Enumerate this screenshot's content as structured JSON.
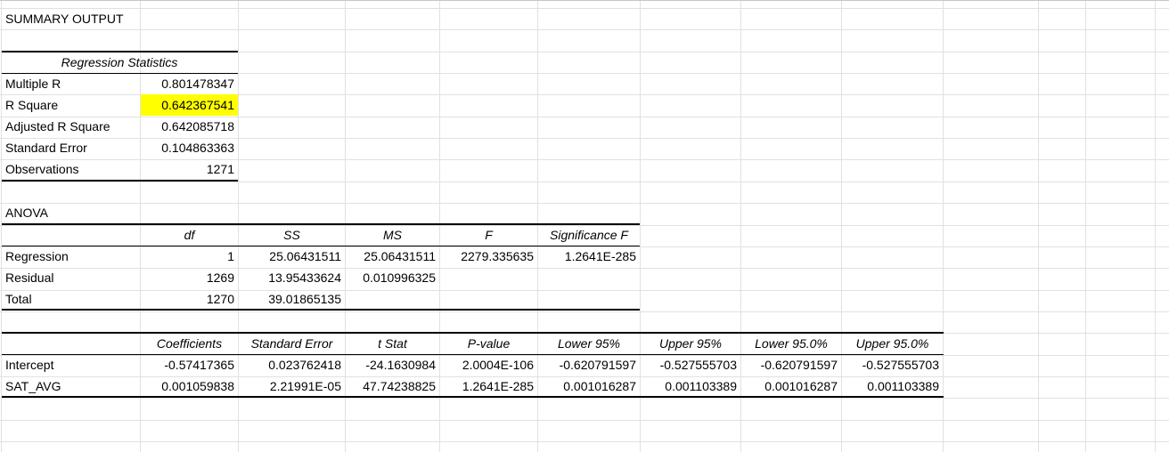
{
  "summary_title": "SUMMARY OUTPUT",
  "regression_statistics": {
    "header": "Regression Statistics",
    "rows": [
      {
        "label": "Multiple R",
        "value": "0.801478347"
      },
      {
        "label": "R Square",
        "value": "0.642367541"
      },
      {
        "label": "Adjusted R Square",
        "value": "0.642085718"
      },
      {
        "label": "Standard Error",
        "value": "0.104863363"
      },
      {
        "label": "Observations",
        "value": "1271"
      }
    ]
  },
  "anova": {
    "title": "ANOVA",
    "headers": [
      "df",
      "SS",
      "MS",
      "F",
      "Significance F"
    ],
    "rows": [
      {
        "label": "Regression",
        "df": "1",
        "ss": "25.06431511",
        "ms": "25.06431511",
        "f": "2279.335635",
        "sig": "1.2641E-285"
      },
      {
        "label": "Residual",
        "df": "1269",
        "ss": "13.95433624",
        "ms": "0.010996325",
        "f": "",
        "sig": ""
      },
      {
        "label": "Total",
        "df": "1270",
        "ss": "39.01865135",
        "ms": "",
        "f": "",
        "sig": ""
      }
    ]
  },
  "coefficients": {
    "headers": [
      "Coefficients",
      "Standard Error",
      "t Stat",
      "P-value",
      "Lower 95%",
      "Upper 95%",
      "Lower 95.0%",
      "Upper 95.0%"
    ],
    "rows": [
      {
        "label": "Intercept",
        "values": [
          "-0.57417365",
          "0.023762418",
          "-24.1630984",
          "2.0004E-106",
          "-0.620791597",
          "-0.527555703",
          "-0.620791597",
          "-0.527555703"
        ]
      },
      {
        "label": "SAT_AVG",
        "values": [
          "0.001059838",
          "2.21991E-05",
          "47.74238825",
          "1.2641E-285",
          "0.001016287",
          "0.001103389",
          "0.001016287",
          "0.001103389"
        ]
      }
    ]
  },
  "colors": {
    "highlight": "#ffff00",
    "gridline": "#e1e1e1"
  }
}
